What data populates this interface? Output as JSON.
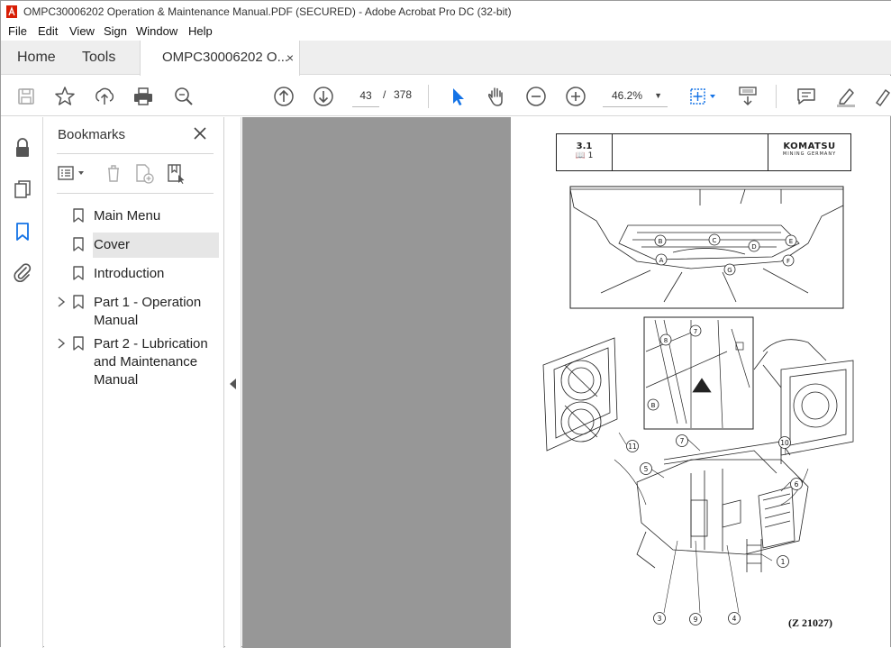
{
  "window": {
    "title": "OMPC30006202 Operation & Maintenance Manual.PDF (SECURED) - Adobe Acrobat Pro DC (32-bit)"
  },
  "menu": {
    "items": [
      "File",
      "Edit",
      "View",
      "Sign",
      "Window",
      "Help"
    ]
  },
  "tabs": {
    "home": "Home",
    "tools": "Tools",
    "doc": "OMPC30006202 O...",
    "close": "×"
  },
  "toolbar": {
    "page_current": "43",
    "page_sep": "/",
    "page_total": "378",
    "zoom": "46.2%",
    "icons": [
      "save-icon",
      "star-icon",
      "upload-icon",
      "print-icon",
      "search-icon",
      "up-arrow-icon",
      "down-arrow-icon",
      "cursor-icon",
      "hand-icon",
      "zoom-out-icon",
      "zoom-in-icon",
      "fit-page-icon",
      "scroll-mode-icon",
      "comment-icon",
      "highlight-icon",
      "draw-icon"
    ],
    "accent": "#1473e6"
  },
  "leftrail": {
    "icons": [
      "lock-icon",
      "pages-icon",
      "bookmark-icon",
      "attachment-icon"
    ]
  },
  "bookmarks": {
    "title": "Bookmarks",
    "close": "✕",
    "items": [
      {
        "label": "Main Menu",
        "expandable": false,
        "selected": false
      },
      {
        "label": "Cover",
        "expandable": false,
        "selected": true
      },
      {
        "label": "Introduction",
        "expandable": false,
        "selected": false
      },
      {
        "label": "Part 1 - Operation Manual",
        "expandable": true,
        "selected": false
      },
      {
        "label": "Part 2 - Lubrication and Maintenance Manual",
        "expandable": true,
        "selected": false
      }
    ]
  },
  "pdf": {
    "section": "3.1",
    "book": "📖 1",
    "brand": "KOMATSU",
    "brand_sub": "MINING GERMANY",
    "figure_ref": "(Z 21027)",
    "top_labels": [
      "A",
      "B",
      "C",
      "D",
      "E",
      "F",
      "G"
    ],
    "callouts": [
      "1",
      "3",
      "4",
      "5",
      "6",
      "7",
      "8",
      "9",
      "10",
      "11"
    ]
  }
}
